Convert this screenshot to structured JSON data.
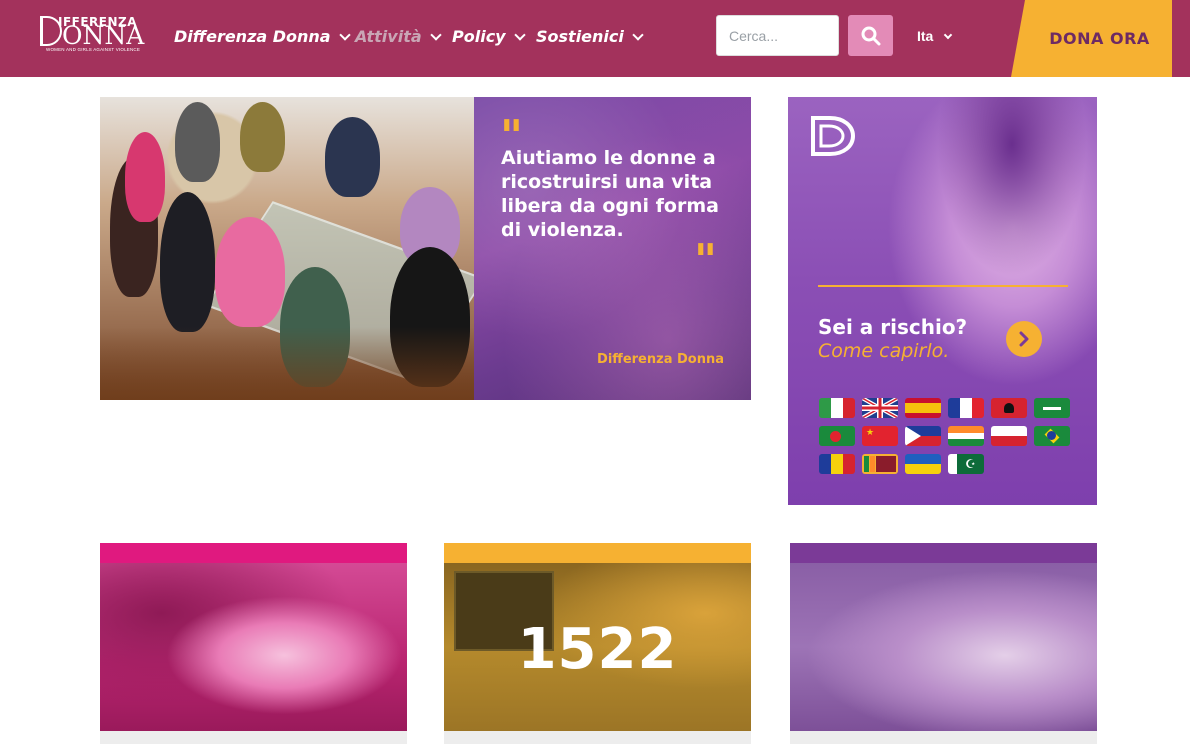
{
  "header": {
    "logo": {
      "top": "IFFERENZA",
      "main": "ONNA",
      "tagline": "WOMEN AND GIRLS AGAINST VIOLENCE"
    },
    "nav": [
      {
        "label": "Differenza Donna",
        "active": false
      },
      {
        "label": "Attività",
        "active": true
      },
      {
        "label": "Policy",
        "active": false
      },
      {
        "label": "Sostienici",
        "active": false
      }
    ],
    "search": {
      "placeholder": "Cerca..."
    },
    "language": "Ita",
    "donate_label": "DONA ORA"
  },
  "hero": {
    "quote": "Aiutiamo le donne a ricostruirsi una vita libera da ogni forma di violenza.",
    "author": "Differenza Donna"
  },
  "risk_card": {
    "title": "Sei a rischio?",
    "subtitle": "Come capirlo.",
    "flags": [
      "italy",
      "united-kingdom",
      "spain",
      "france",
      "albania",
      "saudi-arabia",
      "bangladesh",
      "china",
      "philippines",
      "india",
      "poland",
      "brazil",
      "romania",
      "sri-lanka",
      "ukraine",
      "pakistan"
    ]
  },
  "cards": [
    {
      "color": "#e0197f"
    },
    {
      "color": "#f6b132",
      "number": "1522"
    },
    {
      "color": "#7b3a97"
    }
  ],
  "colors": {
    "header": "#a3325c",
    "accent": "#f6b132",
    "purple": "#8b4fb5"
  }
}
